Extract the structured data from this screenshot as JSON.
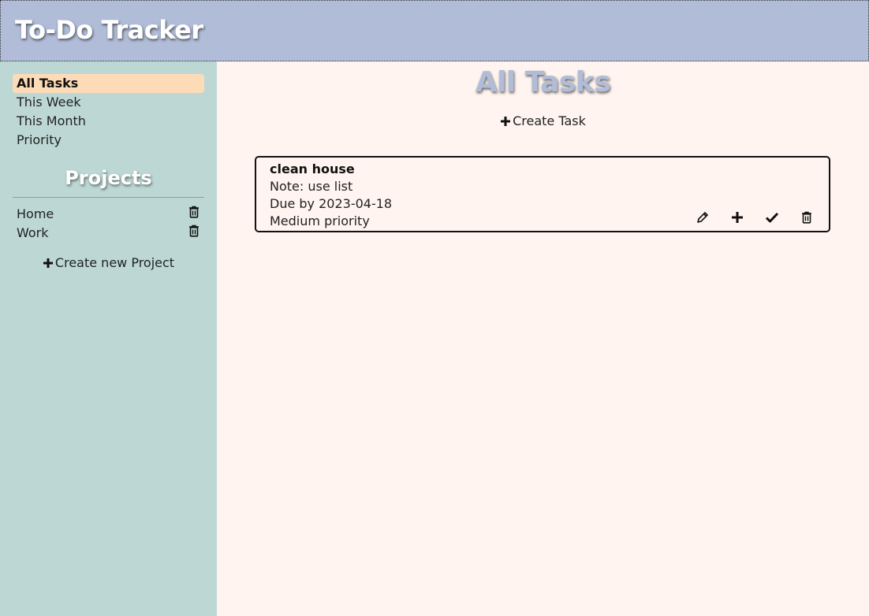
{
  "app": {
    "title": "To-Do Tracker"
  },
  "sidebar": {
    "nav": [
      {
        "label": "All Tasks",
        "active": true
      },
      {
        "label": "This Week"
      },
      {
        "label": "This Month"
      },
      {
        "label": "Priority"
      }
    ],
    "projects_heading": "Projects",
    "projects": [
      {
        "label": "Home",
        "icon": "trash-icon"
      },
      {
        "label": "Work",
        "icon": "trash-icon"
      }
    ],
    "create_project_label": "Create new Project"
  },
  "main": {
    "title": "All Tasks",
    "create_task_label": "Create Task",
    "tasks": [
      {
        "title": "clean house",
        "note": "Note: use list",
        "due": "Due by 2023-04-18",
        "priority": "Medium priority",
        "actions": [
          "pencil-icon",
          "plus-icon",
          "check-icon",
          "trash-icon"
        ]
      }
    ]
  },
  "colors": {
    "header_bg": "#b1bdd8",
    "sidebar_bg": "#bdd8d4",
    "main_bg": "#fff4ef",
    "active_nav_bg": "#fedbb7"
  }
}
